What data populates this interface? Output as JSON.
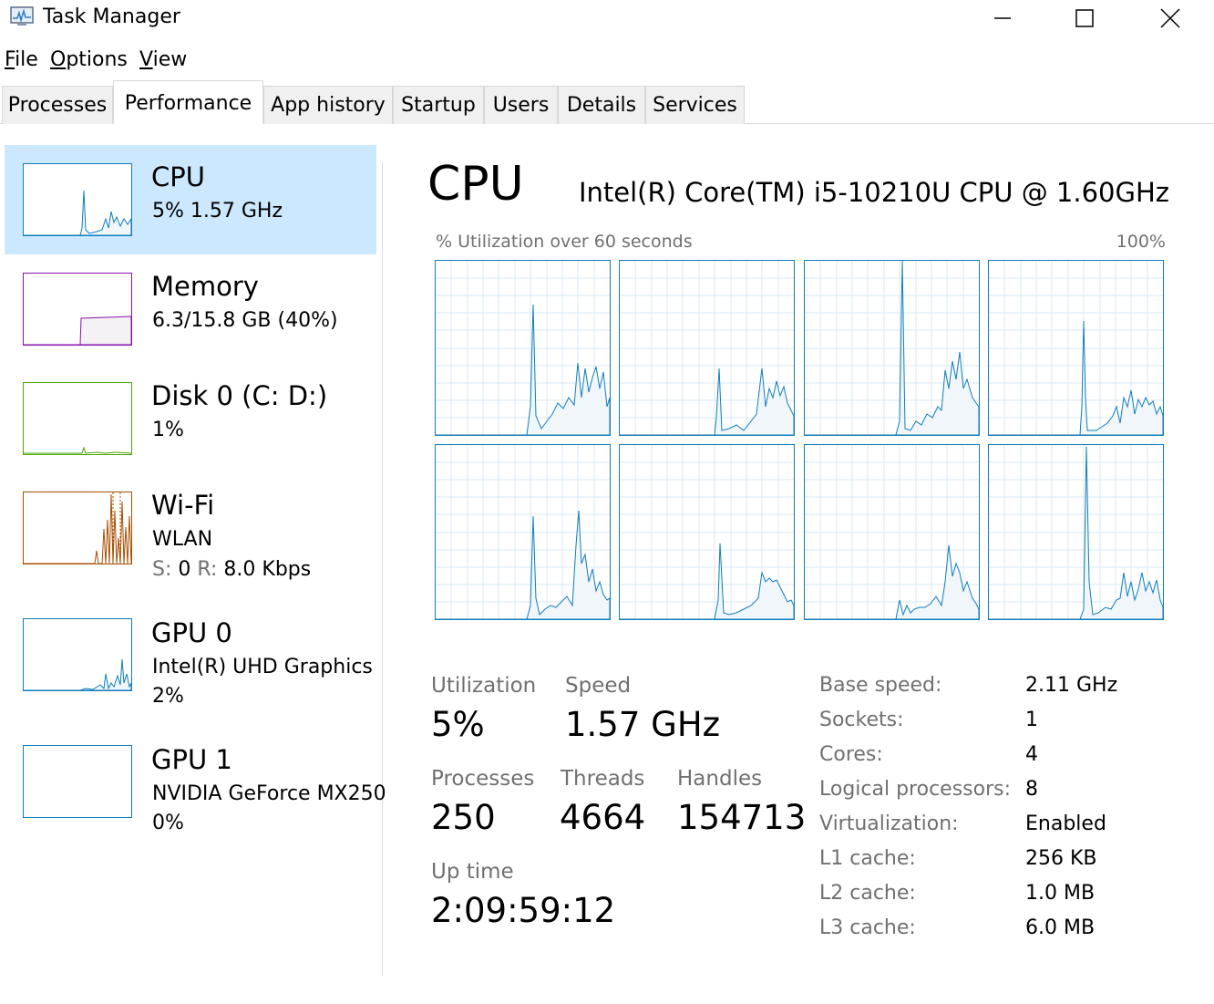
{
  "window": {
    "title": "Task Manager",
    "minimize_label": "—",
    "maximize_label": "☐",
    "close_label": "✕"
  },
  "menu": [
    {
      "underline": "F",
      "rest": "ile"
    },
    {
      "underline": "O",
      "rest": "ptions"
    },
    {
      "underline": "V",
      "rest": "iew"
    }
  ],
  "tabs": [
    "Processes",
    "Performance",
    "App history",
    "Startup",
    "Users",
    "Details",
    "Services"
  ],
  "active_tab": "Performance",
  "sidebar": [
    {
      "title": "CPU",
      "line1": "5%  1.57 GHz",
      "color": "#117dbb",
      "icon": "cpu-graph-icon"
    },
    {
      "title": "Memory",
      "line1": "6.3/15.8 GB (40%)",
      "color": "#8b12ae",
      "icon": "memory-graph-icon"
    },
    {
      "title": "Disk 0 (C: D:)",
      "line1": "1%",
      "color": "#4da60c",
      "icon": "disk-graph-icon"
    },
    {
      "title": "Wi-Fi",
      "line1": "WLAN",
      "s_label": "S:",
      "s_value": "0",
      "r_label": "R:",
      "r_value": "8.0 Kbps",
      "color": "#a74f01",
      "icon": "wifi-graph-icon"
    },
    {
      "title": "GPU 0",
      "line1": "Intel(R) UHD Graphics",
      "line2": "2%",
      "color": "#117dbb",
      "icon": "gpu0-graph-icon"
    },
    {
      "title": "GPU 1",
      "line1": "NVIDIA GeForce MX250",
      "line2": "0%",
      "color": "#117dbb",
      "icon": "gpu1-graph-icon"
    }
  ],
  "main": {
    "title": "CPU",
    "model": "Intel(R) Core(TM) i5-10210U CPU @ 1.60GHz",
    "graph_caption": "% Utilization over 60 seconds",
    "graph_max": "100%",
    "core_count": 8,
    "stats": {
      "utilization_label": "Utilization",
      "utilization_value": "5%",
      "speed_label": "Speed",
      "speed_value": "1.57 GHz",
      "processes_label": "Processes",
      "processes_value": "250",
      "threads_label": "Threads",
      "threads_value": "4664",
      "handles_label": "Handles",
      "handles_value": "154713",
      "uptime_label": "Up time",
      "uptime_value": "2:09:59:12"
    },
    "specs": [
      {
        "label": "Base speed:",
        "value": "2.11 GHz"
      },
      {
        "label": "Sockets:",
        "value": "1"
      },
      {
        "label": "Cores:",
        "value": "4"
      },
      {
        "label": "Logical processors:",
        "value": "8"
      },
      {
        "label": "Virtualization:",
        "value": "Enabled"
      },
      {
        "label": "L1 cache:",
        "value": "256 KB"
      },
      {
        "label": "L2 cache:",
        "value": "1.0 MB"
      },
      {
        "label": "L3 cache:",
        "value": "6.0 MB"
      }
    ]
  },
  "colors": {
    "cpu": "#117dbb",
    "grid": "#d9eaf4",
    "fill": "#f1f6fa",
    "selection": "#cce8ff"
  }
}
